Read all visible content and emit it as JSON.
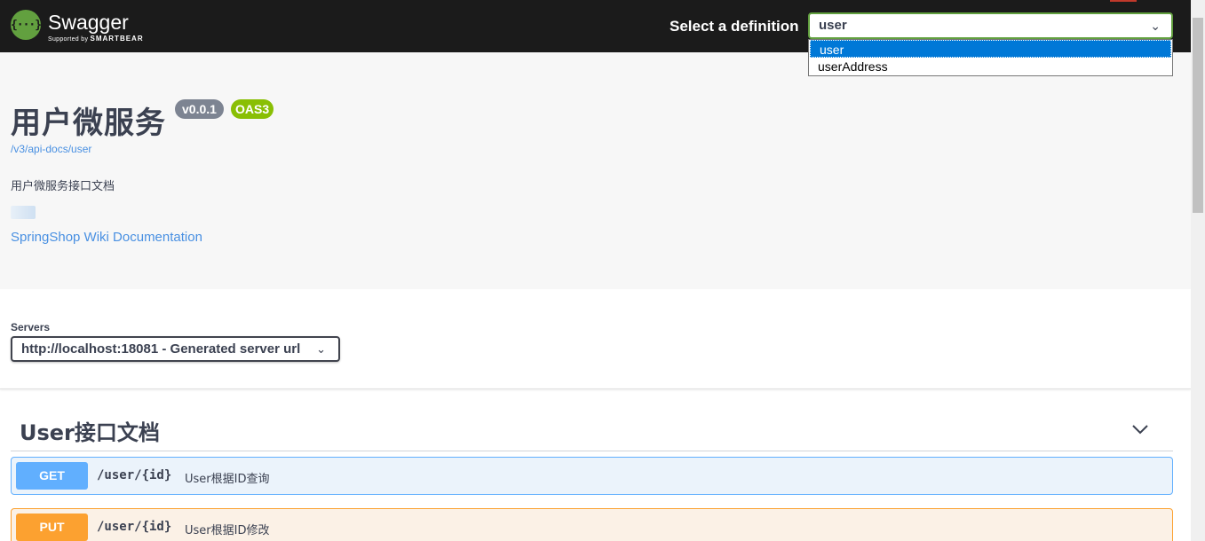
{
  "topbar": {
    "brand": "Swagger",
    "brand_sub_prefix": "Supported by",
    "brand_sub_name": "SMARTBEAR",
    "select_label": "Select a definition",
    "selected_definition": "user",
    "definition_options": [
      "user",
      "userAddress"
    ]
  },
  "info": {
    "title": "用户微服务",
    "version": "v0.0.1",
    "oas_badge": "OAS3",
    "api_docs_link": "/v3/api-docs/user",
    "description": "用户微服务接口文档",
    "wiki_link": "SpringShop Wiki Documentation"
  },
  "servers": {
    "label": "Servers",
    "selected": "http://localhost:18081 - Generated server url"
  },
  "tag": {
    "name": "User接口文档",
    "operations": [
      {
        "method": "GET",
        "path": "/user/{id}",
        "summary": "User根据ID查询"
      },
      {
        "method": "PUT",
        "path": "/user/{id}",
        "summary": "User根据ID修改"
      }
    ]
  },
  "colors": {
    "topbar_bg": "#1b1b1b",
    "brand_green": "#62a03f",
    "get": "#61affe",
    "put": "#fca130",
    "link": "#4990e2",
    "version_badge": "#7d8492",
    "oas_badge": "#89bf04"
  }
}
